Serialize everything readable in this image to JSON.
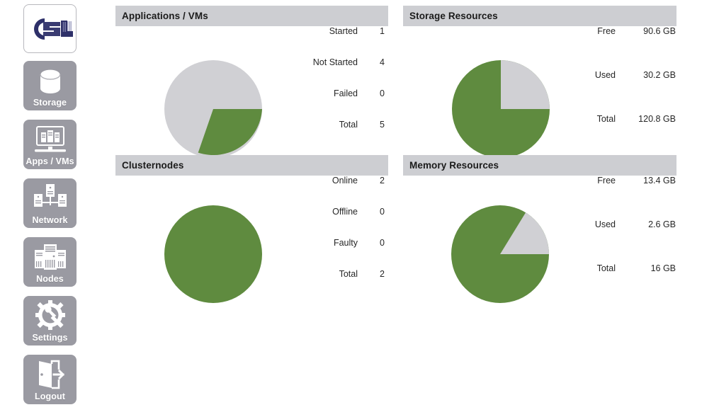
{
  "colors": {
    "green": "#5f8b3f",
    "grey": "#d0d0d4",
    "header_bar": "#cdced2",
    "tile": "#9a9aa2",
    "logo_navy": "#2e3069"
  },
  "sidebar": {
    "items": [
      {
        "id": "logo",
        "label": "",
        "icon": "csl-logo"
      },
      {
        "id": "storage",
        "label": "Storage",
        "icon": "storage-icon"
      },
      {
        "id": "apps",
        "label": "Apps / VMs",
        "icon": "apps-vms-icon"
      },
      {
        "id": "network",
        "label": "Network",
        "icon": "network-icon"
      },
      {
        "id": "nodes",
        "label": "Nodes",
        "icon": "nodes-icon"
      },
      {
        "id": "settings",
        "label": "Settings",
        "icon": "settings-gear-icon"
      },
      {
        "id": "logout",
        "label": "Logout",
        "icon": "logout-door-icon"
      }
    ]
  },
  "panels": [
    {
      "id": "applications-vms",
      "title": "Applications / VMs",
      "rows": [
        {
          "label": "Started",
          "value": "1"
        },
        {
          "label": "Not Started",
          "value": "4"
        },
        {
          "label": "Failed",
          "value": "0"
        },
        {
          "label": "Total",
          "value": "5"
        }
      ]
    },
    {
      "id": "storage-resources",
      "title": "Storage Resources",
      "rows": [
        {
          "label": "Free",
          "value": "90.6 GB"
        },
        {
          "label": "Used",
          "value": "30.2 GB"
        },
        {
          "label": "Total",
          "value": "120.8 GB"
        }
      ]
    },
    {
      "id": "clusternodes",
      "title": "Clusternodes",
      "rows": [
        {
          "label": "Online",
          "value": "2"
        },
        {
          "label": "Offline",
          "value": "0"
        },
        {
          "label": "Faulty",
          "value": "0"
        },
        {
          "label": "Total",
          "value": "2"
        }
      ]
    },
    {
      "id": "memory-resources",
      "title": "Memory Resources",
      "rows": [
        {
          "label": "Free",
          "value": "13.4 GB"
        },
        {
          "label": "Used",
          "value": "2.6 GB"
        },
        {
          "label": "Total",
          "value": "16 GB"
        }
      ]
    }
  ],
  "chart_data": [
    {
      "type": "pie",
      "id": "applications-vms-pie",
      "title": "Applications / VMs",
      "categories": [
        "Started",
        "Not Started",
        "Failed"
      ],
      "values": [
        1,
        4,
        0
      ],
      "total": 5,
      "colors": [
        "#5f8b3f",
        "#d0d0d4",
        "#d0d0d4"
      ],
      "start_angle_deg": 0,
      "direction": "clockwise",
      "legend": "right",
      "grid": false
    },
    {
      "type": "pie",
      "id": "storage-resources-pie",
      "title": "Storage Resources",
      "categories": [
        "Used",
        "Free"
      ],
      "values": [
        30.2,
        90.6
      ],
      "unit": "GB",
      "total": 120.8,
      "colors": [
        "#d0d0d4",
        "#5f8b3f"
      ],
      "start_angle_deg": -90,
      "direction": "clockwise",
      "legend": "right",
      "grid": false
    },
    {
      "type": "pie",
      "id": "clusternodes-pie",
      "title": "Clusternodes",
      "categories": [
        "Online",
        "Offline",
        "Faulty"
      ],
      "values": [
        2,
        0,
        0
      ],
      "total": 2,
      "colors": [
        "#5f8b3f",
        "#d0d0d4",
        "#d0d0d4"
      ],
      "start_angle_deg": 0,
      "direction": "clockwise",
      "legend": "right",
      "grid": false
    },
    {
      "type": "pie",
      "id": "memory-resources-pie",
      "title": "Memory Resources",
      "categories": [
        "Used",
        "Free"
      ],
      "values": [
        2.6,
        13.4
      ],
      "unit": "GB",
      "total": 16,
      "colors": [
        "#d0d0d4",
        "#5f8b3f"
      ],
      "start_angle_deg": -58.5,
      "direction": "clockwise",
      "legend": "right",
      "grid": false
    }
  ]
}
